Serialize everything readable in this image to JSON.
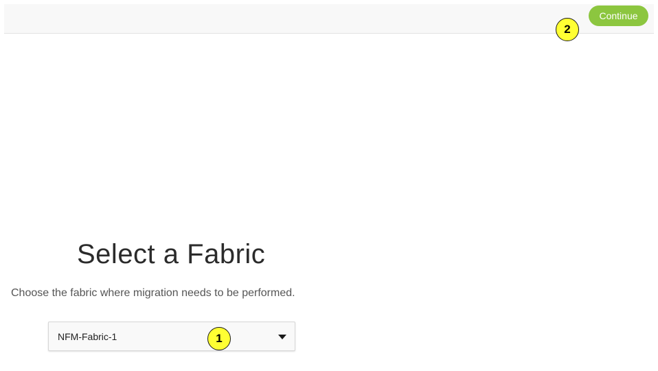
{
  "header": {
    "continue_label": "Continue",
    "callout_number": "2"
  },
  "main": {
    "title": "Select a Fabric",
    "subtitle": "Choose the fabric where migration needs to be performed.",
    "fabric_select": {
      "selected_value": "NFM-Fabric-1",
      "callout_number": "1"
    }
  },
  "colors": {
    "accent_green": "#8cc63f",
    "callout_yellow": "#ffff33",
    "topbar_bg": "#f8f8f8"
  },
  "icons": {
    "dropdown": "chevron-down-icon"
  }
}
